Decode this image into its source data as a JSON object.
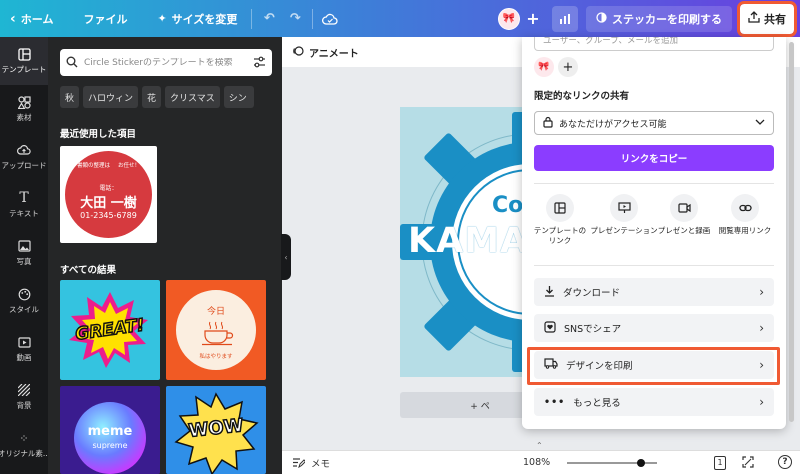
{
  "topbar": {
    "home_label": "ホーム",
    "file_label": "ファイル",
    "resize_label": "サイズを変更",
    "print_label": "ステッカーを印刷する",
    "share_label": "共有"
  },
  "sidebar": {
    "items": [
      {
        "label": "テンプレート"
      },
      {
        "label": "素材"
      },
      {
        "label": "アップロード"
      },
      {
        "label": "テキスト"
      },
      {
        "label": "写真"
      },
      {
        "label": "スタイル"
      },
      {
        "label": "動画"
      },
      {
        "label": "背景"
      },
      {
        "label": "オリジナル素..."
      }
    ]
  },
  "panel": {
    "search_placeholder": "Circle Stickerのテンプレートを検索",
    "chips": [
      "秋",
      "ハロウィン",
      "花",
      "クリスマス",
      "シン"
    ],
    "recent_title": "最近使用した項目",
    "results_title": "すべての結果",
    "recent_thumb": {
      "top_text": "書類の整理は",
      "top_text2": "お任せ！",
      "phone_label": "電話：",
      "name": "大田 一樹",
      "phone": "01-2345-6789",
      "color": "#d63a3f"
    },
    "result_thumbs": [
      {
        "text": "GREAT!",
        "bg": "#34c3e0"
      },
      {
        "text": "今日",
        "sub": "私はやります",
        "bg": "#f15a24"
      },
      {
        "text": "meme",
        "sub": "supreme",
        "bg": "#3a1c8f"
      },
      {
        "text": "WOW",
        "bg": "#2f8fe8"
      }
    ]
  },
  "canvas": {
    "animate_label": "アニメート",
    "design_text_top": "Coo",
    "design_text_main": "KAMA",
    "add_page_label": "+ ペ",
    "memo_label": "メモ",
    "zoom": "108%",
    "zoom_fraction": 0.82,
    "page_count": "1",
    "colors": {
      "gear": "#1a8fc5",
      "bg": "#b6dde6"
    }
  },
  "share_panel": {
    "people_placeholder": "ユーザー、グループ、メールを追加",
    "link_title": "限定的なリンクの共有",
    "access_value": "あなただけがアクセス可能",
    "copy_link_label": "リンクをコピー",
    "options": [
      {
        "label": "テンプレートの",
        "label2": "リンク"
      },
      {
        "label": "プレゼンテーション",
        "label2": ""
      },
      {
        "label": "プレゼンと録画",
        "label2": ""
      },
      {
        "label": "閲覧専用リンク",
        "label2": ""
      }
    ],
    "rows": [
      {
        "label": "ダウンロード"
      },
      {
        "label": "SNSでシェア"
      },
      {
        "label": "デザインを印刷"
      },
      {
        "label": "もっと見る"
      }
    ],
    "accent": "#8b3dff",
    "highlight_color": "#f05a33"
  }
}
